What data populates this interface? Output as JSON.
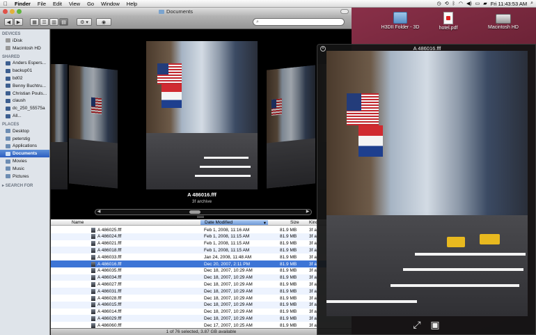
{
  "menubar": {
    "apple_icon": "apple-icon",
    "items": [
      "Finder",
      "File",
      "Edit",
      "View",
      "Go",
      "Window",
      "Help"
    ],
    "clock": "Fri 11:43:53 AM"
  },
  "desktop": {
    "icons": [
      {
        "label": "H3DII Folder - 3D",
        "icon": "folder-icon"
      },
      {
        "label": "hotel.pdf",
        "icon": "pdf-file-icon"
      },
      {
        "label": "Macintosh HD",
        "icon": "hard-drive-icon"
      }
    ]
  },
  "finder": {
    "title": "Documents",
    "toolbar": {
      "back": "◀",
      "forward": "▶",
      "action": "⚙ ▾",
      "quicklook": "◉"
    },
    "search_placeholder": "",
    "sidebar": {
      "sections": [
        {
          "header": "DEVICES",
          "items": [
            "iDisk",
            "Macintosh HD"
          ]
        },
        {
          "header": "SHARED",
          "items": [
            "Anders Espers...",
            "backup01",
            "bd02",
            "Benny Buchtru...",
            "Christian Pouls...",
            "claush",
            "dc_250_55575a",
            "All..."
          ]
        },
        {
          "header": "PLACES",
          "items": [
            "Desktop",
            "peterstig",
            "Applications",
            "Documents",
            "Movies",
            "Music",
            "Pictures"
          ]
        },
        {
          "header": "SEARCH FOR",
          "items": []
        }
      ],
      "selected": "Documents"
    },
    "coverflow": {
      "caption_name": "A 486016.fff",
      "caption_kind": "3f archive"
    },
    "list": {
      "headers": {
        "name": "Name",
        "date": "Date Modified",
        "size": "Size",
        "kind": "Kind"
      },
      "rows": [
        {
          "name": "A 486025.fff",
          "date": "Feb 1, 2008, 11:16 AM",
          "size": "81.9 MB",
          "kind": "3f a"
        },
        {
          "name": "A 486024.fff",
          "date": "Feb 1, 2008, 11:15 AM",
          "size": "81.9 MB",
          "kind": "3f a"
        },
        {
          "name": "A 486021.fff",
          "date": "Feb 1, 2008, 11:15 AM",
          "size": "81.9 MB",
          "kind": "3f a"
        },
        {
          "name": "A 486018.fff",
          "date": "Feb 1, 2008, 11:15 AM",
          "size": "81.9 MB",
          "kind": "3f a"
        },
        {
          "name": "A 486033.fff",
          "date": "Jan 24, 2008, 11:48 AM",
          "size": "81.9 MB",
          "kind": "3f a"
        },
        {
          "name": "A 486016.fff",
          "date": "Dec 20, 2007, 2:11 PM",
          "size": "81.9 MB",
          "kind": "3f a"
        },
        {
          "name": "A 486035.fff",
          "date": "Dec 18, 2007, 10:29 AM",
          "size": "81.9 MB",
          "kind": "3f a"
        },
        {
          "name": "A 486034.fff",
          "date": "Dec 18, 2007, 10:29 AM",
          "size": "81.9 MB",
          "kind": "3f a"
        },
        {
          "name": "A 486027.fff",
          "date": "Dec 18, 2007, 10:29 AM",
          "size": "81.9 MB",
          "kind": "3f a"
        },
        {
          "name": "A 486031.fff",
          "date": "Dec 18, 2007, 10:29 AM",
          "size": "81.9 MB",
          "kind": "3f a"
        },
        {
          "name": "A 486028.fff",
          "date": "Dec 18, 2007, 10:29 AM",
          "size": "81.9 MB",
          "kind": "3f a"
        },
        {
          "name": "A 486015.fff",
          "date": "Dec 18, 2007, 10:29 AM",
          "size": "81.9 MB",
          "kind": "3f a"
        },
        {
          "name": "A 486014.fff",
          "date": "Dec 18, 2007, 10:29 AM",
          "size": "81.9 MB",
          "kind": "3f a"
        },
        {
          "name": "A 486029.fff",
          "date": "Dec 18, 2007, 10:29 AM",
          "size": "81.9 MB",
          "kind": "3f a"
        },
        {
          "name": "A 486060.fff",
          "date": "Dec 17, 2007, 10:25 AM",
          "size": "81.9 MB",
          "kind": "3f a"
        },
        {
          "name": "A 486063.fff",
          "date": "Dec 17, 2007, 10:25 AM",
          "size": "81.9 MB",
          "kind": "3f a"
        }
      ],
      "selected_index": 5
    },
    "status": "1 of 76 selected, 3.87 GB available"
  },
  "quicklook": {
    "title": "A 486016.fff",
    "close": "×",
    "fullscreen_icon": "⤢",
    "add_to_iphoto_icon": "▣"
  },
  "colors": {
    "selection": "#3d75d6",
    "sidebar_bg": "#dfe4ea"
  }
}
